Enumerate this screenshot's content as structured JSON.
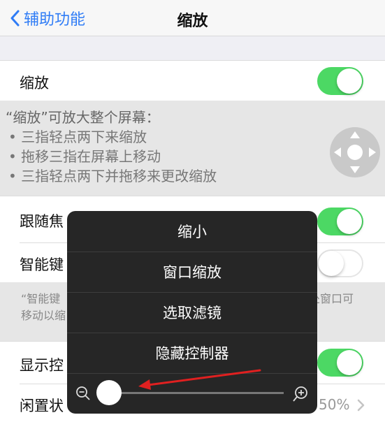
{
  "navbar": {
    "back_label": "辅助功能",
    "title": "缩放"
  },
  "zoom_row": {
    "label": "缩放",
    "toggle": true
  },
  "description": {
    "title": "“缩放”可放大整个屏幕：",
    "lines": [
      "• 三指轻点两下来缩放",
      "• 拖移三指在屏幕上移动",
      "• 三指轻点两下并拖移来更改缩放"
    ]
  },
  "follow_focus": {
    "label": "跟随焦",
    "toggle": true
  },
  "smart_keyboard": {
    "label": "智能键",
    "toggle": false
  },
  "smart_keyboard_footer": {
    "line1_left": "“智能键",
    "line1_right": "处窗口可",
    "line2_left": "移动以缩"
  },
  "show_controller": {
    "label": "显示控",
    "toggle": true
  },
  "idle": {
    "label": "闲置状",
    "value": "50%"
  },
  "popup": {
    "items": [
      "缩小",
      "窗口缩放",
      "选取滤镜",
      "隐藏控制器"
    ],
    "slider_level": 0.0
  },
  "colors": {
    "accent_blue": "#2f7cf6",
    "toggle_green": "#4cd864",
    "annotation_red": "#e02020"
  }
}
